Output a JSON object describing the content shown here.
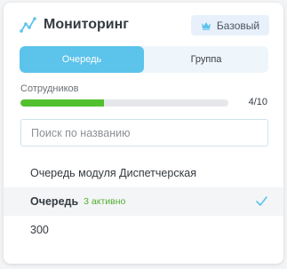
{
  "header": {
    "title": "Мониторинг",
    "plan_label": "Базовый",
    "logo_icon": "trend-line-icon",
    "plan_icon": "crown-icon"
  },
  "tabs": [
    {
      "label": "Очередь",
      "active": true
    },
    {
      "label": "Группа",
      "active": false
    }
  ],
  "employees": {
    "label": "Сотрудников",
    "count_text": "4/10",
    "progress_fraction": 0.4
  },
  "search": {
    "placeholder": "Поиск по названию",
    "value": ""
  },
  "queues": [
    {
      "name": "Очередь модуля Диспетчерская",
      "active_text": "",
      "selected": false
    },
    {
      "name": "Очередь",
      "active_text": "3 активно",
      "selected": true
    },
    {
      "name": "300",
      "active_text": "",
      "selected": false
    }
  ],
  "colors": {
    "accent": "#5cc3ea",
    "progress": "#52c02f",
    "active_text": "#52b02f",
    "check": "#5cc3ea"
  }
}
